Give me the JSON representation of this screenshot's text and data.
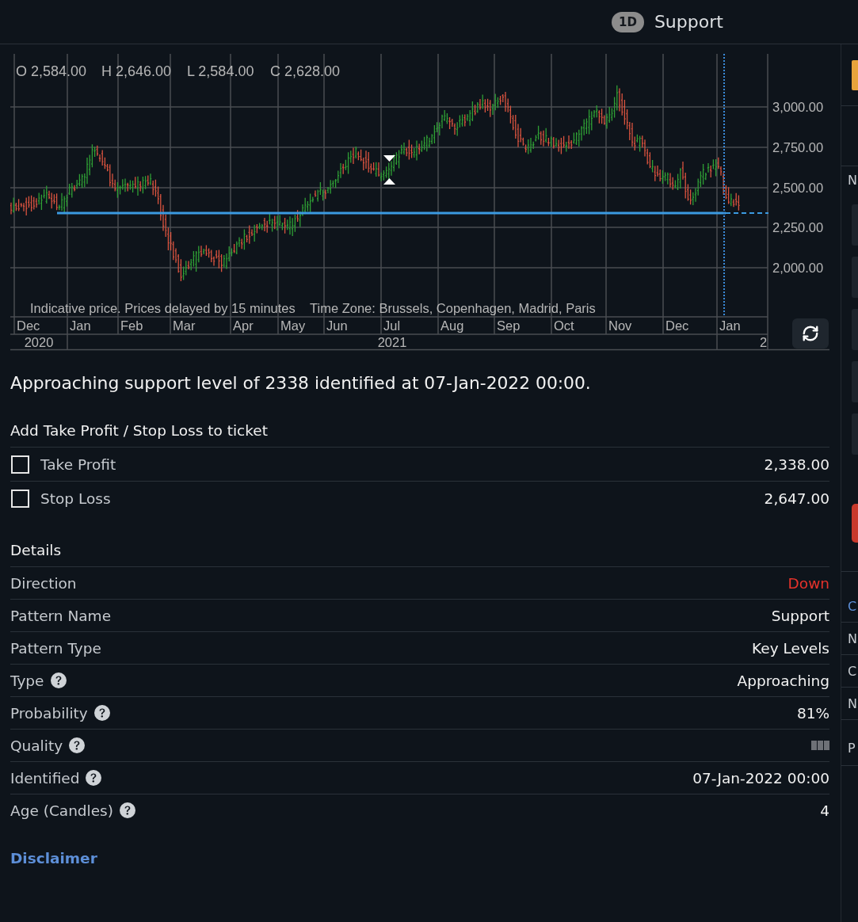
{
  "header": {
    "interval": "1D",
    "title": "Support"
  },
  "chart": {
    "ohlc": [
      {
        "label": "O",
        "value": "2,584.00"
      },
      {
        "label": "H",
        "value": "2,646.00"
      },
      {
        "label": "L",
        "value": "2,584.00"
      },
      {
        "label": "C",
        "value": "2,628.00"
      }
    ],
    "price_labels": [
      "3,000.00",
      "2,750.00",
      "2,500.00",
      "2,250.00",
      "2,000.00"
    ],
    "months": [
      "Dec",
      "Jan",
      "Feb",
      "Mar",
      "Apr",
      "May",
      "Jun",
      "Jul",
      "Aug",
      "Sep",
      "Oct",
      "Nov",
      "Dec",
      "Jan"
    ],
    "years": [
      "2020",
      "2021",
      "2"
    ],
    "notice": "Indicative price. Prices delayed by 15 minutes",
    "time_zone": "Time Zone: Brussels, Copenhagen, Madrid, Paris"
  },
  "summary": "Approaching support level of 2338 identified at 07-Jan-2022 00:00.",
  "ticket": {
    "title": "Add Take Profit / Stop Loss to ticket",
    "options": [
      {
        "label": "Take Profit",
        "value": "2,338.00",
        "checked": false
      },
      {
        "label": "Stop Loss",
        "value": "2,647.00",
        "checked": false
      }
    ]
  },
  "details": {
    "title": "Details",
    "rows": [
      {
        "label": "Direction",
        "help": false,
        "kind": "negative",
        "value": "Down"
      },
      {
        "label": "Pattern Name",
        "help": false,
        "kind": "text",
        "value": "Support"
      },
      {
        "label": "Pattern Type",
        "help": false,
        "kind": "text",
        "value": "Key Levels"
      },
      {
        "label": "Type",
        "help": true,
        "kind": "text",
        "value": "Approaching"
      },
      {
        "label": "Probability",
        "help": true,
        "kind": "text",
        "value": "81%"
      },
      {
        "label": "Quality",
        "help": true,
        "kind": "bars"
      },
      {
        "label": "Identified",
        "help": true,
        "kind": "text",
        "value": "07-Jan-2022 00:00"
      },
      {
        "label": "Age (Candles)",
        "help": true,
        "kind": "text",
        "value": "4"
      }
    ]
  },
  "disclaimer": "Disclaimer",
  "side_panel": [
    {
      "kind": "tile"
    },
    {
      "kind": "label",
      "text": "N"
    },
    {
      "kind": "block"
    },
    {
      "kind": "block"
    },
    {
      "kind": "block"
    },
    {
      "kind": "block"
    },
    {
      "kind": "block"
    },
    {
      "kind": "button"
    },
    {
      "kind": "heading",
      "text": "C"
    },
    {
      "kind": "row",
      "text": "N"
    },
    {
      "kind": "row",
      "text": "C"
    },
    {
      "kind": "row",
      "text": "N"
    },
    {
      "kind": "row",
      "text": "P"
    }
  ]
}
